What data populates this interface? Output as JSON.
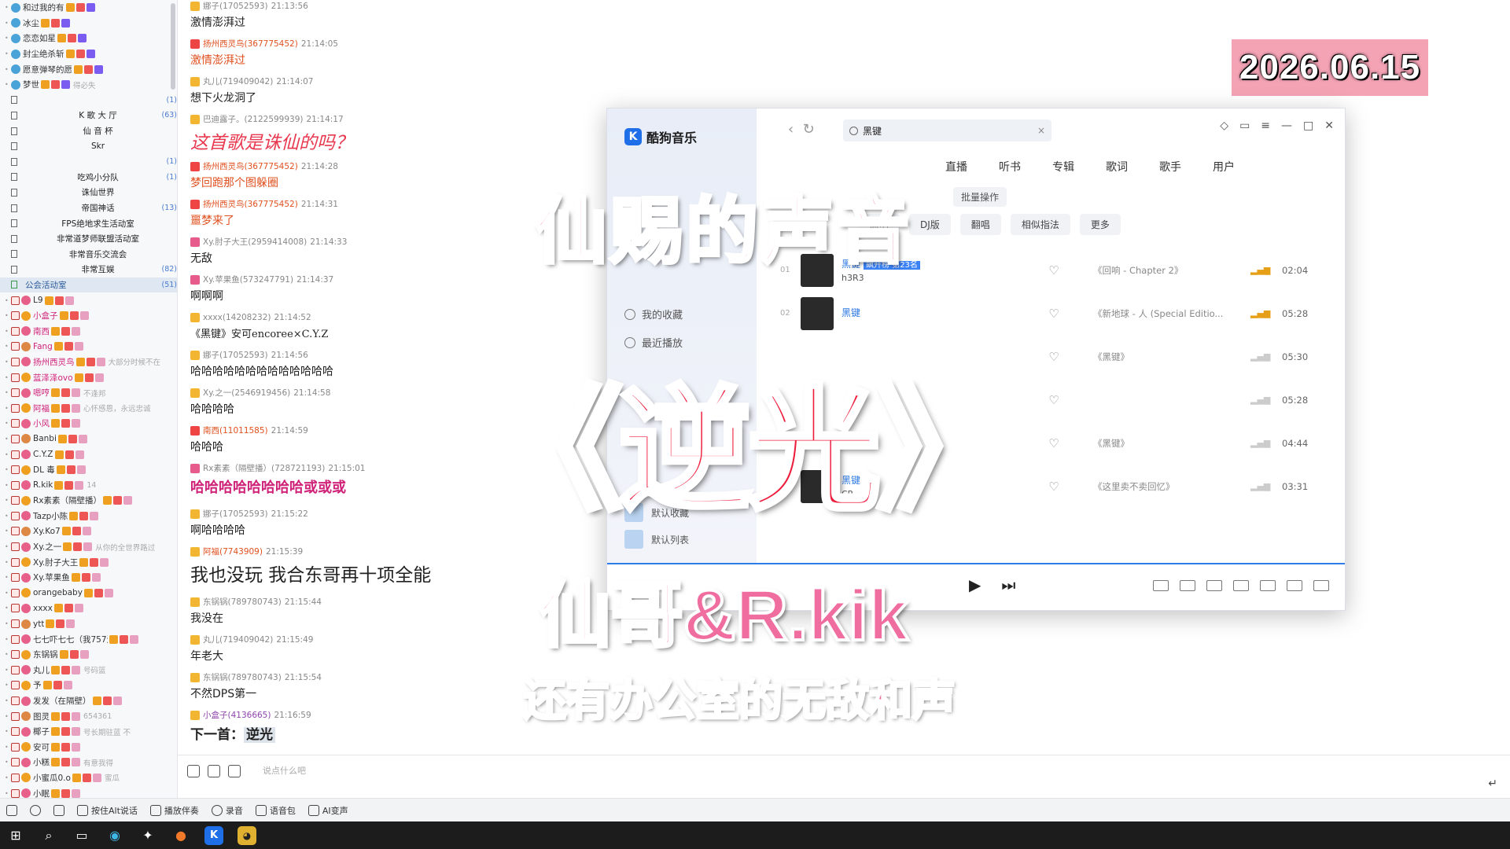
{
  "user_list": {
    "top_users": [
      {
        "name": "和过我的有"
      },
      {
        "name": "冰尘"
      },
      {
        "name": "恋恋如星"
      },
      {
        "name": "封尘绝杀斩"
      },
      {
        "name": "愿意弹琴的愿"
      },
      {
        "name": "梦世",
        "sig": "得必失"
      }
    ],
    "channels": [
      {
        "name": "",
        "count": "(1)"
      },
      {
        "name": "K 歌 大 厅",
        "count": "(63)"
      },
      {
        "name": "仙 音 杯",
        "count": ""
      },
      {
        "name": "Skr",
        "count": ""
      },
      {
        "name": "",
        "count": "(1)"
      },
      {
        "name": "吃鸡小分队",
        "count": "(1)"
      },
      {
        "name": "诛仙世界",
        "count": ""
      },
      {
        "name": "帝国神话",
        "count": "(13)"
      },
      {
        "name": "FPS绝地求生活动室",
        "count": ""
      },
      {
        "name": "非常道梦师联盟活动室",
        "count": ""
      },
      {
        "name": "非常音乐交流会",
        "count": ""
      },
      {
        "name": "非常互娱",
        "count": "(82)"
      }
    ],
    "active_channel": {
      "name": "公会活动室",
      "count": "(51)"
    },
    "members": [
      {
        "name": "L9",
        "style": ""
      },
      {
        "name": "小盒子",
        "style": "vip"
      },
      {
        "name": "南西",
        "style": "vip"
      },
      {
        "name": "Fang",
        "style": "vip"
      },
      {
        "name": "扬州西灵鸟",
        "style": "vip",
        "sig": "大部分时候不在"
      },
      {
        "name": "蓝泽泽ovo",
        "style": "vip"
      },
      {
        "name": "嗯哼",
        "style": "vip",
        "sig": "不逢邦"
      },
      {
        "name": "阿福",
        "style": "vip",
        "sig": "心怀感恩，永远忠诚"
      },
      {
        "name": "小风",
        "style": "vip"
      },
      {
        "name": "Banbi",
        "style": ""
      },
      {
        "name": "C.Y.Z",
        "style": ""
      },
      {
        "name": "DL 毒",
        "style": ""
      },
      {
        "name": "R.kik",
        "style": "",
        "sig": "14"
      },
      {
        "name": "Rx素素（隔壁播）",
        "style": ""
      },
      {
        "name": "Tazp小陈",
        "style": ""
      },
      {
        "name": "Xy.Ko7",
        "style": ""
      },
      {
        "name": "Xy.之一",
        "style": "",
        "sig": "从你的全世界路过"
      },
      {
        "name": "Xy.肘子大王",
        "style": ""
      },
      {
        "name": "Xy.苹果鱼",
        "style": ""
      },
      {
        "name": "orangebaby",
        "style": ""
      },
      {
        "name": "xxxx",
        "style": ""
      },
      {
        "name": "ytt",
        "style": ""
      },
      {
        "name": "七七吓七七（我757活动版）",
        "style": ""
      },
      {
        "name": "东锅锅",
        "style": ""
      },
      {
        "name": "丸儿",
        "style": "",
        "sig": "号码篮"
      },
      {
        "name": "予",
        "style": ""
      },
      {
        "name": "发发（在隔壁）",
        "style": ""
      },
      {
        "name": "图灵",
        "style": "",
        "sig": "654361"
      },
      {
        "name": "椰子",
        "style": "",
        "sig": "号长期驻蓝 不"
      },
      {
        "name": "安可",
        "style": ""
      },
      {
        "name": "小糕",
        "style": "",
        "sig": "有意我得"
      },
      {
        "name": "小蜜瓜0.o",
        "style": "",
        "sig": "蜜瓜"
      },
      {
        "name": "小眠",
        "style": ""
      }
    ]
  },
  "chat": {
    "messages": [
      {
        "name": "娜子(17052593)",
        "time": "21:13:56",
        "text": "激情澎湃过",
        "name_style": "",
        "text_style": "",
        "icon": ""
      },
      {
        "name": "扬州西灵鸟(367775452)",
        "time": "21:14:05",
        "text": "激情澎湃过",
        "name_style": "red",
        "text_style": "red",
        "icon": "red"
      },
      {
        "name": "丸儿(719409042)",
        "time": "21:14:07",
        "text": "想下火龙洞了",
        "name_style": "",
        "text_style": "",
        "icon": ""
      },
      {
        "name": "巴迪露子。(2122599939)",
        "time": "21:14:17",
        "text": "这首歌是诛仙的吗？",
        "name_style": "",
        "text_style": "big-red",
        "icon": ""
      },
      {
        "name": "扬州西灵鸟(367775452)",
        "time": "21:14:28",
        "text": "梦回跑那个图躲圈",
        "name_style": "red",
        "text_style": "red",
        "icon": "red"
      },
      {
        "name": "扬州西灵鸟(367775452)",
        "time": "21:14:31",
        "text": "噩梦来了",
        "name_style": "red",
        "text_style": "red",
        "icon": "red"
      },
      {
        "name": "Xy.肘子大王(2959414008)",
        "time": "21:14:33",
        "text": "无敌",
        "name_style": "",
        "text_style": "",
        "icon": "pink"
      },
      {
        "name": "Xy.苹果鱼(573247791)",
        "time": "21:14:37",
        "text": "啊啊啊",
        "name_style": "",
        "text_style": "",
        "icon": "pink"
      },
      {
        "name": "xxxx(14208232)",
        "time": "21:14:52",
        "text": "《黑键》安可encoree×C.Y.Z",
        "name_style": "",
        "text_style": "serif",
        "icon": ""
      },
      {
        "name": "娜子(17052593)",
        "time": "21:14:56",
        "text": "哈哈哈哈哈哈哈哈哈哈哈哈哈",
        "name_style": "",
        "text_style": "",
        "icon": ""
      },
      {
        "name": "Xy.之一(2546919456)",
        "time": "21:14:58",
        "text": "哈哈哈哈",
        "name_style": "",
        "text_style": "",
        "icon": ""
      },
      {
        "name": "南西(11011585)",
        "time": "21:14:59",
        "text": "哈哈哈",
        "name_style": "red",
        "text_style": "",
        "icon": "red"
      },
      {
        "name": "Rx素素（隔壁播）(728721193)",
        "time": "21:15:01",
        "text": "哈哈哈哈哈哈哈哈或或或",
        "name_style": "",
        "text_style": "bold-mag",
        "icon": "pink"
      },
      {
        "name": "娜子(17052593)",
        "time": "21:15:22",
        "text": "啊哈哈哈哈",
        "name_style": "",
        "text_style": "",
        "icon": ""
      },
      {
        "name": "阿福(7743909)",
        "time": "21:15:39",
        "text": "我也没玩 我合东哥再十项全能",
        "name_style": "red",
        "text_style": "large",
        "icon": ""
      },
      {
        "name": "东锅锅(789780743)",
        "time": "21:15:44",
        "text": "我没在",
        "name_style": "",
        "text_style": "",
        "icon": ""
      },
      {
        "name": "丸儿(719409042)",
        "time": "21:15:49",
        "text": "年老大",
        "name_style": "",
        "text_style": "",
        "icon": ""
      },
      {
        "name": "东锅锅(789780743)",
        "time": "21:15:54",
        "text": "不然DPS第一",
        "name_style": "",
        "text_style": "",
        "icon": ""
      },
      {
        "name": "小盒子(4136665)",
        "time": "21:16:59",
        "text": "下一首：",
        "song": "逆光",
        "name_style": "purple",
        "text_style": "next",
        "icon": ""
      }
    ],
    "input_placeholder": "说点什么吧"
  },
  "bottom_toolbar": [
    {
      "label": "按住Alt说话"
    },
    {
      "label": "播放伴奏"
    },
    {
      "label": "录音"
    },
    {
      "label": "语音包"
    },
    {
      "label": "AI变声"
    }
  ],
  "date_badge": "2026.06.15",
  "music_app": {
    "app_name": "酷狗音乐",
    "search_value": "黑键",
    "side_items": [
      {
        "label": "我的收藏"
      },
      {
        "label": "最近播放"
      }
    ],
    "playlists": [
      {
        "label": "默认收藏"
      },
      {
        "label": "默认列表"
      }
    ],
    "tabs": [
      "直播",
      "听书",
      "专辑",
      "歌词",
      "歌手",
      "用户"
    ],
    "batch_label": "批量操作",
    "filters": [
      "原唱",
      "DJ版",
      "翻唱",
      "相似指法",
      "更多"
    ],
    "rows": [
      {
        "no": "01",
        "title": "黑键",
        "tag": "飙升榜 第23名",
        "artist": "h3R3",
        "album": "《回响 - Chapter 2》",
        "duration": "02:04",
        "signal": "strong"
      },
      {
        "no": "02",
        "title": "黑键",
        "tag": "",
        "artist": "",
        "album": "《新地球 - 人 (Special Editio...",
        "duration": "05:28",
        "signal": "strong"
      },
      {
        "no": "",
        "title": "",
        "tag": "",
        "artist": "",
        "album": "《黑键》",
        "duration": "05:30",
        "signal": "weak"
      },
      {
        "no": "",
        "title": "",
        "tag": "",
        "artist": "",
        "album": "",
        "duration": "05:28",
        "signal": "weak"
      },
      {
        "no": "",
        "title": "",
        "tag": "",
        "artist": "",
        "album": "《黑键》",
        "duration": "04:44",
        "signal": "weak"
      },
      {
        "no": "06",
        "title": "黑键",
        "tag": "",
        "artist": "CR",
        "album": "《这里卖不卖回忆》",
        "duration": "03:31",
        "signal": "weak"
      }
    ]
  },
  "overlay": {
    "subtitle": "仙赐的声音",
    "song_title": "《逆光》",
    "artists": "仙哥&R.kik",
    "note": "还有办公室的无敌和声"
  },
  "colors": {
    "overlay_pink": "#f06da0",
    "overlay_red": "#ee1c3c",
    "badge_bg": "#f4a3b5",
    "app_accent": "#2e7ce6"
  }
}
